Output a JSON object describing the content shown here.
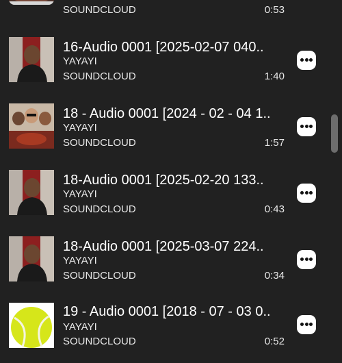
{
  "tracks": [
    {
      "title": "",
      "artist": "",
      "source": "SOUNDCLOUD",
      "duration": "0:53",
      "thumb": "person"
    },
    {
      "title": "16-Audio 0001 [2025-02-07 040..",
      "artist": "YAYAYI",
      "source": "SOUNDCLOUD",
      "duration": "1:40",
      "thumb": "person"
    },
    {
      "title": "18 - Audio 0001 [2024 - 02 - 04 1..",
      "artist": "YAYAYI",
      "source": "SOUNDCLOUD",
      "duration": "1:57",
      "thumb": "group"
    },
    {
      "title": "18-Audio 0001 [2025-02-20 133..",
      "artist": "YAYAYI",
      "source": "SOUNDCLOUD",
      "duration": "0:43",
      "thumb": "person"
    },
    {
      "title": "18-Audio 0001 [2025-03-07 224..",
      "artist": "YAYAYI",
      "source": "SOUNDCLOUD",
      "duration": "0:34",
      "thumb": "person"
    },
    {
      "title": "19 - Audio 0001 [2018 - 07 - 03 0..",
      "artist": "YAYAYI",
      "source": "SOUNDCLOUD",
      "duration": "0:52",
      "thumb": "tennis-ball"
    }
  ],
  "colors": {
    "background": "#212121",
    "text": "#ffffff",
    "more_button": "#ffffff",
    "scrollbar": "#6d6d6d"
  }
}
